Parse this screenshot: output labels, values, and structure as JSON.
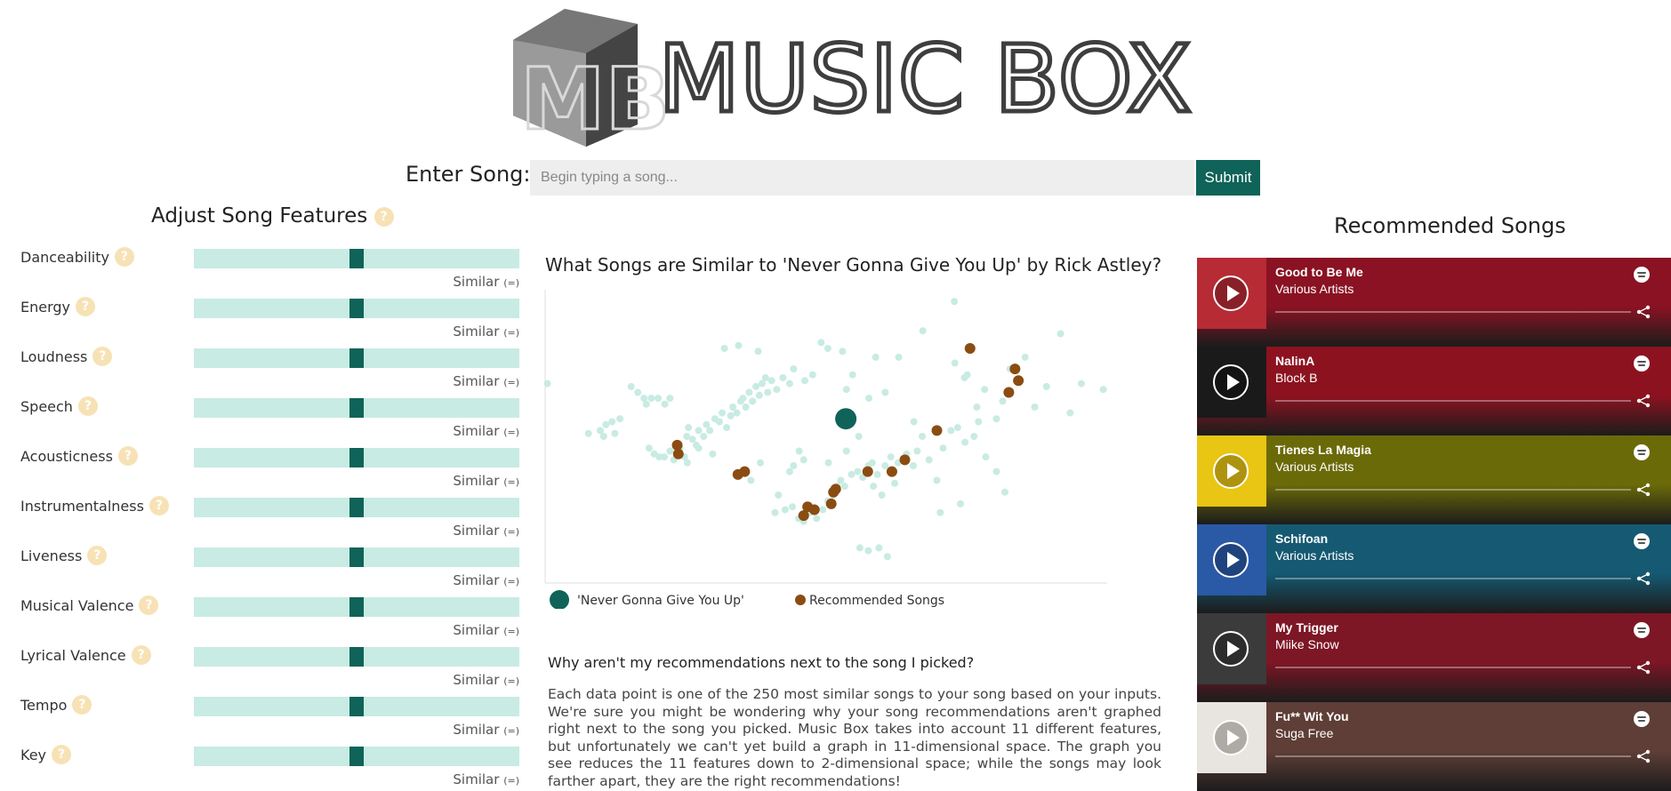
{
  "header": {
    "logo_monogram": "MB",
    "logo_text": "MUSIC BOX"
  },
  "search": {
    "label": "Enter Song:",
    "placeholder": "Begin typing a song...",
    "submit_label": "Submit"
  },
  "features": {
    "title": "Adjust Song Features",
    "help_glyph": "?",
    "items": [
      {
        "label": "Danceability",
        "caption": "Similar",
        "paren": "(=)",
        "level": 0.5
      },
      {
        "label": "Energy",
        "caption": "Similar",
        "paren": "(=)",
        "level": 0.5
      },
      {
        "label": "Loudness",
        "caption": "Similar",
        "paren": "(=)",
        "level": 0.5
      },
      {
        "label": "Speech",
        "caption": "Similar",
        "paren": "(=)",
        "level": 0.5
      },
      {
        "label": "Acousticness",
        "caption": "Similar",
        "paren": "(=)",
        "level": 0.5
      },
      {
        "label": "Instrumentalness",
        "caption": "Similar",
        "paren": "(=)",
        "level": 0.5
      },
      {
        "label": "Liveness",
        "caption": "Similar",
        "paren": "(=)",
        "level": 0.5
      },
      {
        "label": "Musical Valence",
        "caption": "Similar",
        "paren": "(=)",
        "level": 0.5
      },
      {
        "label": "Lyrical Valence",
        "caption": "Similar",
        "paren": "(=)",
        "level": 0.5
      },
      {
        "label": "Tempo",
        "caption": "Similar",
        "paren": "(=)",
        "level": 0.5
      },
      {
        "label": "Key",
        "caption": "Similar",
        "paren": "(=)",
        "level": 0.5
      }
    ]
  },
  "chart": {
    "title": "What Songs are Similar to 'Never Gonna Give You Up' by Rick Astley?",
    "legend": [
      {
        "label": "'Never Gonna Give You Up'",
        "color": "#0f6358"
      },
      {
        "label": "Recommended Songs",
        "color": "#8b4c12"
      }
    ],
    "colors": {
      "similar": "#c8ebe3",
      "selected": "#0f6358",
      "recommended": "#8b4c12",
      "axis": "#dddddd"
    }
  },
  "chart_data": {
    "type": "scatter",
    "title": "What Songs are Similar to 'Never Gonna Give You Up' by Rick Astley?",
    "xlabel": "",
    "ylabel": "",
    "xlim": [
      0,
      100
    ],
    "ylim": [
      0,
      100
    ],
    "series": [
      {
        "name": "'Never Gonna Give You Up'",
        "points": [
          [
            53.5,
            56
          ]
        ]
      },
      {
        "name": "Recommended Songs",
        "points": [
          [
            23.5,
            47
          ],
          [
            23.7,
            44
          ],
          [
            34.3,
            37
          ],
          [
            35.5,
            38
          ],
          [
            46.7,
            26
          ],
          [
            46,
            23
          ],
          [
            47.9,
            25
          ],
          [
            50.9,
            27
          ],
          [
            51.3,
            31
          ],
          [
            51.7,
            32
          ],
          [
            57.4,
            38
          ],
          [
            61.7,
            38
          ],
          [
            64,
            42
          ],
          [
            69.7,
            52
          ],
          [
            75.6,
            80
          ],
          [
            82.5,
            65
          ],
          [
            84.2,
            69
          ],
          [
            83.6,
            73
          ]
        ]
      },
      {
        "name": "",
        "points": [
          [
            0.4,
            68
          ],
          [
            7.7,
            51
          ],
          [
            9.8,
            52
          ],
          [
            10.8,
            54
          ],
          [
            10.4,
            50
          ],
          [
            11.9,
            55
          ],
          [
            12.4,
            51
          ],
          [
            13.3,
            56
          ],
          [
            15.3,
            67
          ],
          [
            16.5,
            65
          ],
          [
            17.6,
            63
          ],
          [
            18,
            61
          ],
          [
            18.9,
            63
          ],
          [
            20.1,
            63
          ],
          [
            21.3,
            61
          ],
          [
            22.2,
            63
          ],
          [
            18.5,
            46
          ],
          [
            19.4,
            44
          ],
          [
            20.3,
            43
          ],
          [
            21.2,
            43
          ],
          [
            22.2,
            45
          ],
          [
            22.9,
            42
          ],
          [
            24,
            46
          ],
          [
            24.8,
            43
          ],
          [
            25.2,
            50
          ],
          [
            25.5,
            53
          ],
          [
            26.2,
            49
          ],
          [
            26.9,
            47
          ],
          [
            27.3,
            52
          ],
          [
            28.2,
            50
          ],
          [
            28.7,
            54
          ],
          [
            29.3,
            52
          ],
          [
            30.2,
            56
          ],
          [
            31,
            55
          ],
          [
            31.5,
            58
          ],
          [
            32.3,
            53
          ],
          [
            33,
            57
          ],
          [
            33.4,
            60
          ],
          [
            34.1,
            58
          ],
          [
            34.8,
            62
          ],
          [
            35.2,
            63
          ],
          [
            35.7,
            60
          ],
          [
            36.3,
            65
          ],
          [
            36.9,
            62
          ],
          [
            37.5,
            67
          ],
          [
            38.1,
            64
          ],
          [
            38.6,
            68
          ],
          [
            39.2,
            70
          ],
          [
            39.6,
            65
          ],
          [
            40.3,
            69
          ],
          [
            41.2,
            66
          ],
          [
            42.3,
            70
          ],
          [
            43.5,
            68
          ],
          [
            44.2,
            73
          ],
          [
            46.2,
            69
          ],
          [
            47.6,
            71
          ],
          [
            31.9,
            80
          ],
          [
            34.4,
            81
          ],
          [
            37.9,
            79
          ],
          [
            49.1,
            82
          ],
          [
            50.3,
            80
          ],
          [
            52.9,
            79
          ],
          [
            54.7,
            71
          ],
          [
            58.8,
            77
          ],
          [
            62.9,
            77
          ],
          [
            67.2,
            86
          ],
          [
            72.9,
            75
          ],
          [
            75.1,
            71
          ],
          [
            76.8,
            60
          ],
          [
            78.2,
            66
          ],
          [
            80.3,
            56
          ],
          [
            81.4,
            62
          ],
          [
            82.7,
            73
          ],
          [
            85.4,
            77
          ],
          [
            87.1,
            60
          ],
          [
            89.2,
            67
          ],
          [
            91.7,
            85
          ],
          [
            93.4,
            58
          ],
          [
            95.4,
            68
          ],
          [
            99.3,
            66
          ],
          [
            72.8,
            96
          ],
          [
            74.6,
            70
          ],
          [
            43.5,
            38
          ],
          [
            44.2,
            40
          ],
          [
            45.2,
            45
          ],
          [
            46,
            42
          ],
          [
            41.5,
            30
          ],
          [
            40.9,
            24
          ],
          [
            42.7,
            25
          ],
          [
            44,
            26
          ],
          [
            45.1,
            22
          ],
          [
            46,
            21
          ],
          [
            47.1,
            24
          ],
          [
            48.3,
            22
          ],
          [
            49.4,
            25
          ],
          [
            50.3,
            28
          ],
          [
            51.2,
            30
          ],
          [
            52,
            33
          ],
          [
            52.6,
            35
          ],
          [
            53.3,
            33
          ],
          [
            54.5,
            37
          ],
          [
            55.6,
            38
          ],
          [
            56.5,
            36
          ],
          [
            57.5,
            40
          ],
          [
            58.2,
            41
          ],
          [
            59.1,
            37
          ],
          [
            60.5,
            40
          ],
          [
            61.5,
            43
          ],
          [
            62.8,
            41
          ],
          [
            64.3,
            44
          ],
          [
            65.5,
            40
          ],
          [
            66.2,
            45
          ],
          [
            67.1,
            50
          ],
          [
            68.3,
            42
          ],
          [
            50.4,
            41
          ],
          [
            53.6,
            45
          ],
          [
            55.8,
            50
          ],
          [
            58.4,
            33
          ],
          [
            59.9,
            30
          ],
          [
            62.2,
            34
          ],
          [
            69.7,
            35
          ],
          [
            70.8,
            46
          ],
          [
            72.2,
            52
          ],
          [
            73.4,
            53
          ],
          [
            74.7,
            48
          ],
          [
            76.3,
            50
          ],
          [
            77.1,
            55
          ],
          [
            78.4,
            43
          ],
          [
            80.3,
            38
          ],
          [
            81.8,
            31
          ],
          [
            73.9,
            27
          ],
          [
            70.3,
            24
          ],
          [
            56,
            12
          ],
          [
            57.5,
            11
          ],
          [
            59.4,
            12
          ],
          [
            60.9,
            9
          ],
          [
            38.3,
            41
          ],
          [
            36.6,
            35
          ],
          [
            29.8,
            44
          ],
          [
            27.3,
            46
          ],
          [
            25.3,
            41
          ],
          [
            53.6,
            66
          ],
          [
            57.6,
            63
          ],
          [
            60.5,
            65
          ],
          [
            65.6,
            55
          ]
        ]
      }
    ]
  },
  "explanation": {
    "title": "Why aren't my recommendations next to the song I picked?",
    "body": "Each data point is one of the 250 most similar songs to your song based on your inputs. We're sure you might be wondering why your song recommendations aren't graphed right next to the song you picked. Music Box takes into account 11 different features, but unfortunately we can't yet build a graph in 11-dimensional space. The graph you see reduces the 11 features down to 2-dimensional space; while the songs may look farther apart, they are the right recommendations!"
  },
  "recommendations": {
    "title": "Recommended Songs",
    "items": [
      {
        "song": "Good to Be Me",
        "artist": "Various Artists",
        "bg": "#8a1222",
        "art": "#b72b35"
      },
      {
        "song": "NalinA",
        "artist": "Block B",
        "bg": "#8d1220",
        "art": "#1a1a1a"
      },
      {
        "song": "Tienes La Magia",
        "artist": "Various Artists",
        "bg": "#6b6a08",
        "art": "#e9c514"
      },
      {
        "song": "Schifoan",
        "artist": "Various Artists",
        "bg": "#155a72",
        "art": "#2a5aa6"
      },
      {
        "song": "My Trigger",
        "artist": "Miike Snow",
        "bg": "#7d1625",
        "art": "#3b3b3b"
      },
      {
        "song": "Fu** Wit You",
        "artist": "Suga Free",
        "bg": "#5f3e37",
        "art": "#e8e4df"
      }
    ]
  }
}
